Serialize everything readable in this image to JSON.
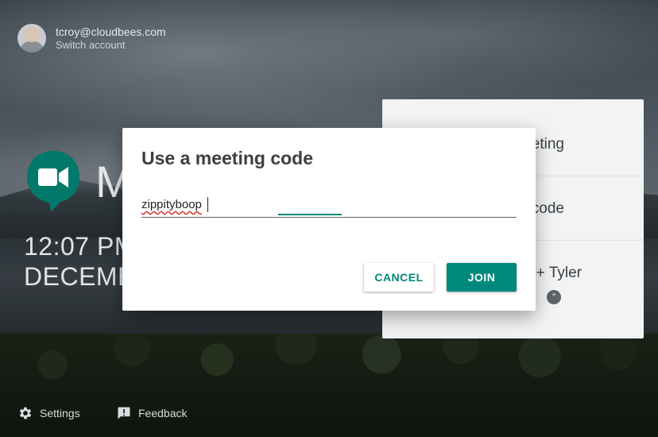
{
  "account": {
    "email": "tcroy@cloudbees.com",
    "switch_label": "Switch account"
  },
  "home": {
    "logo_letter": "M",
    "time": "12:07 PM",
    "date": "DECEMB"
  },
  "panel": {
    "rows": [
      {
        "label": "eting"
      },
      {
        "label": "code"
      },
      {
        "label": "+ Tyler",
        "chat_glyph": "”"
      }
    ]
  },
  "dialog": {
    "title": "Use a meeting code",
    "code_value": "zippityboop",
    "cancel_label": "CANCEL",
    "join_label": "JOIN"
  },
  "footer": {
    "settings_label": "Settings",
    "feedback_label": "Feedback"
  },
  "colors": {
    "accent": "#00897b",
    "logo_green": "#00796b"
  }
}
